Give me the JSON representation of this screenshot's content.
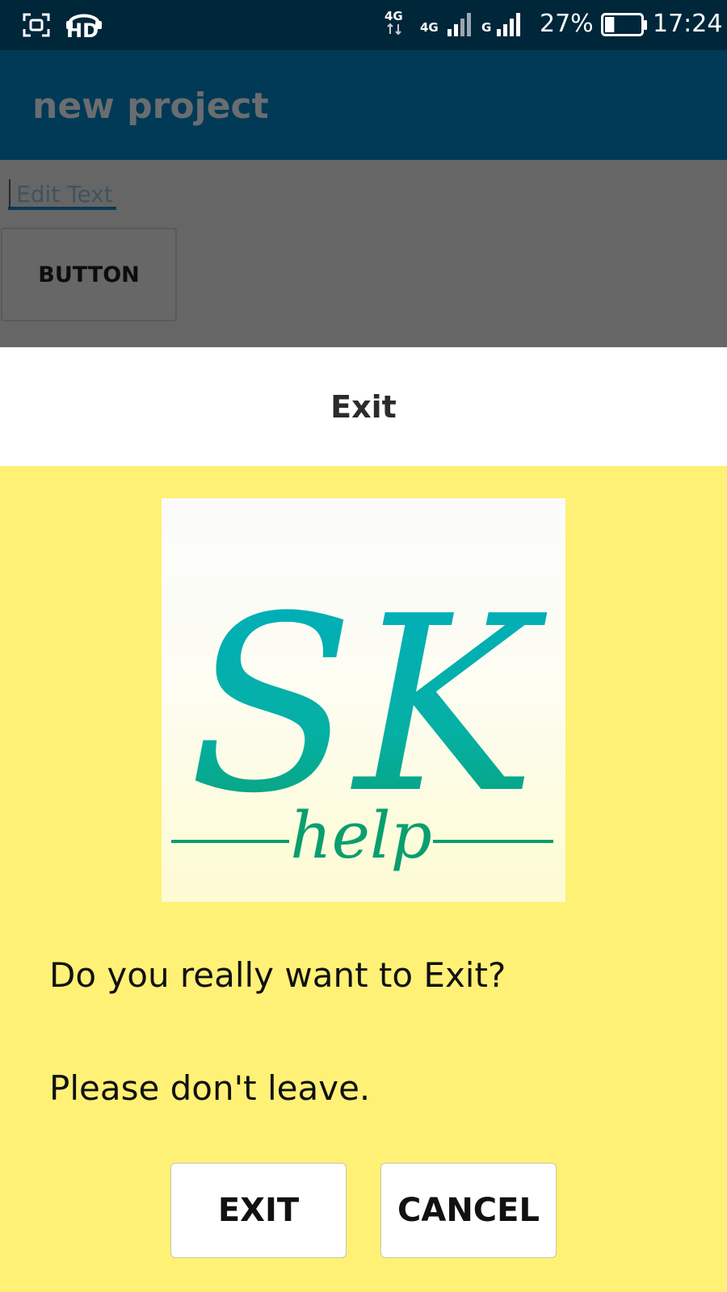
{
  "status_bar": {
    "network_1": "4G",
    "network_2": "4G",
    "network_3": "G",
    "battery_percent": "27%",
    "battery_level": 0.27,
    "time": "17:24",
    "hd_label": "HD",
    "icons": [
      "screenshot-icon",
      "hd-voice-icon",
      "signal-icon",
      "battery-icon"
    ]
  },
  "app_bar": {
    "title": "new project"
  },
  "content": {
    "edit_text_hint": "Edit Text",
    "button_label": "BUTTON"
  },
  "dialog": {
    "title": "Exit",
    "logo_text": "SK",
    "logo_subtext": "help",
    "message_1": "Do you really want to Exit?",
    "message_2": "Please don't leave.",
    "exit_label": "EXIT",
    "cancel_label": "CANCEL"
  },
  "colors": {
    "status_bar": "#00263a",
    "app_bar": "#003a56",
    "dialog_body": "#fff176",
    "logo_teal": "#00aabb",
    "logo_green": "#0a9e6e"
  }
}
